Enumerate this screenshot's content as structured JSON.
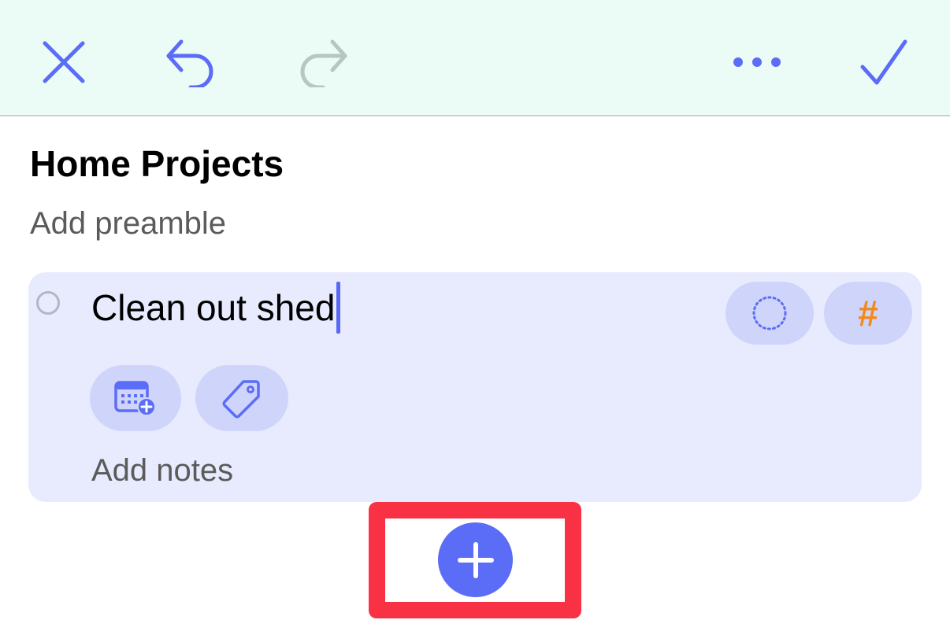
{
  "toolbar": {
    "close_icon": "close-icon",
    "undo_icon": "undo-icon",
    "redo_icon": "redo-icon",
    "more_icon": "more-icon",
    "done_icon": "checkmark-icon"
  },
  "list": {
    "title": "Home Projects",
    "preamble_placeholder": "Add preamble"
  },
  "task": {
    "title": "Clean out shed",
    "tag_symbol": "#",
    "notes_placeholder": "Add notes",
    "buttons": [
      "progress-circle-icon",
      "hashtag-icon",
      "calendar-add-icon",
      "tag-icon"
    ]
  },
  "add_button": {
    "icon": "plus-icon"
  },
  "colors": {
    "accent": "#5b6cf7",
    "toolbar_bg": "#ebfcf6",
    "card_bg": "#e8ebfd",
    "pill_bg": "#cfd4fb",
    "tag_orange": "#f28a1d",
    "highlight_red": "#f83244",
    "redo_disabled": "#b7c7bf"
  }
}
